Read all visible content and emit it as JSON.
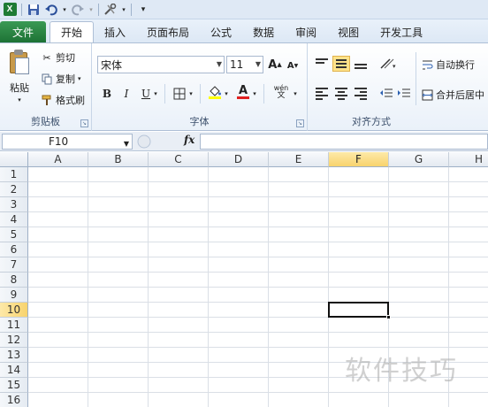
{
  "qat": {
    "excel_logo": "X",
    "icons": [
      "excel-logo-icon",
      "save-icon",
      "undo-icon",
      "redo-icon",
      "customize-icon"
    ]
  },
  "tabs": {
    "file": "文件",
    "items": [
      "开始",
      "插入",
      "页面布局",
      "公式",
      "数据",
      "审阅",
      "视图",
      "开发工具"
    ],
    "active": "开始"
  },
  "clipboard": {
    "paste": "粘贴",
    "cut": "剪切",
    "copy": "复制",
    "format_painter": "格式刷",
    "label": "剪贴板"
  },
  "font": {
    "name": "宋体",
    "size": "11",
    "bold": "B",
    "italic": "I",
    "underline": "U",
    "grow": "A",
    "shrink": "A",
    "color_letter": "A",
    "phonetic": "wén",
    "label": "字体",
    "fill_color": "#ffff00",
    "font_color": "#e02020"
  },
  "alignment": {
    "wrap": "自动换行",
    "merge": "合并后居中",
    "label": "对齐方式"
  },
  "formula_bar": {
    "name_box": "F10",
    "fx": "fx",
    "value": ""
  },
  "sheet": {
    "columns": [
      "A",
      "B",
      "C",
      "D",
      "E",
      "F",
      "G",
      "H"
    ],
    "rows": [
      "1",
      "2",
      "3",
      "4",
      "5",
      "6",
      "7",
      "8",
      "9",
      "10",
      "11",
      "12",
      "13",
      "14",
      "15",
      "16"
    ],
    "selected_col": "F",
    "selected_row": "10"
  },
  "watermark": "软件技巧",
  "colors": {
    "file_tab": "#1d7235",
    "selection_header": "#f8d36d"
  }
}
